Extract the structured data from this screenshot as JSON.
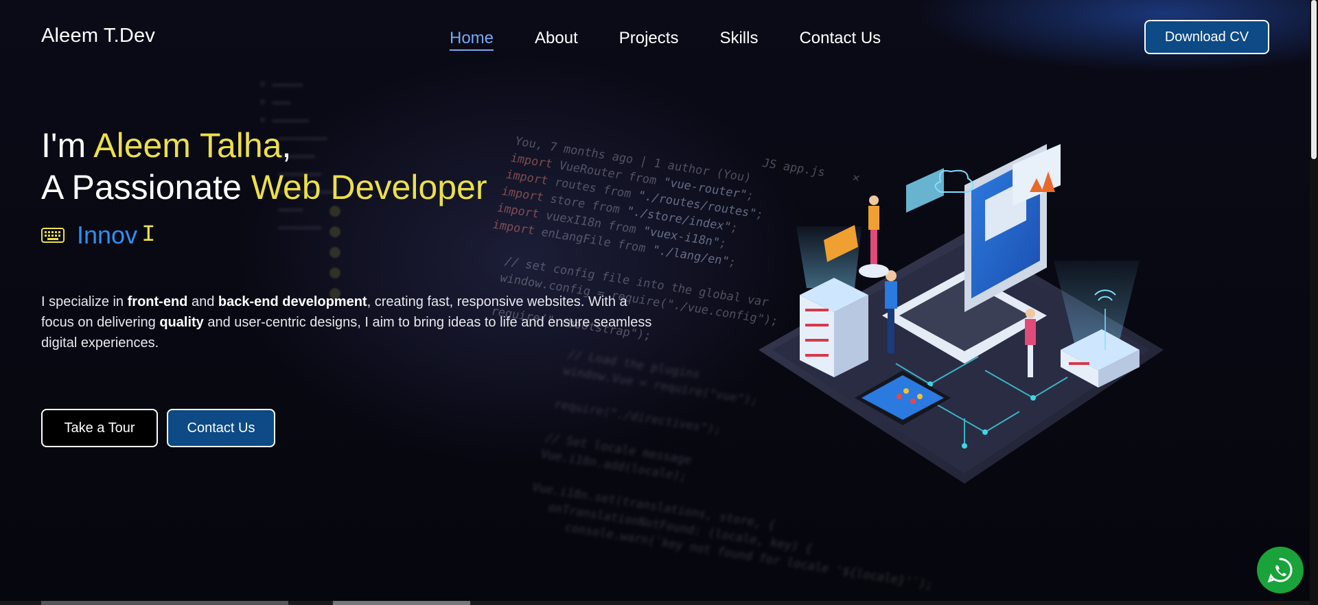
{
  "brand": "Aleem T.Dev",
  "nav": {
    "items": [
      "Home",
      "About",
      "Projects",
      "Skills",
      "Contact Us"
    ],
    "active": "Home"
  },
  "download_cv": "Download CV",
  "hero": {
    "line1_prefix": "I'm ",
    "line1_name": "Aleem Talha",
    "line1_suffix": ",",
    "line2_prefix": "A Passionate ",
    "line2_role": "Web Developer",
    "typed_word": "Innov",
    "typed_icon": "keyboard-icon",
    "description": {
      "p1": "I specialize in ",
      "b1": "front-end",
      "p2": " and ",
      "b2": "back-end development",
      "p3": ", creating fast, responsive websites. With a focus on delivering ",
      "b3": "quality",
      "p4": " and user-centric designs, I aim to bring ideas to life and ensure seamless digital experiences."
    }
  },
  "buttons": {
    "tour": "Take a Tour",
    "contact": "Contact Us"
  },
  "colors": {
    "accent_yellow": "#ece04a",
    "accent_blue": "#2f8ff0",
    "nav_active": "#78a8f0",
    "button_blue": "#0d4a86",
    "whatsapp": "#1aa33a"
  },
  "icons": {
    "whatsapp": "whatsapp-icon",
    "illustration": "isometric-dev-illustration"
  }
}
